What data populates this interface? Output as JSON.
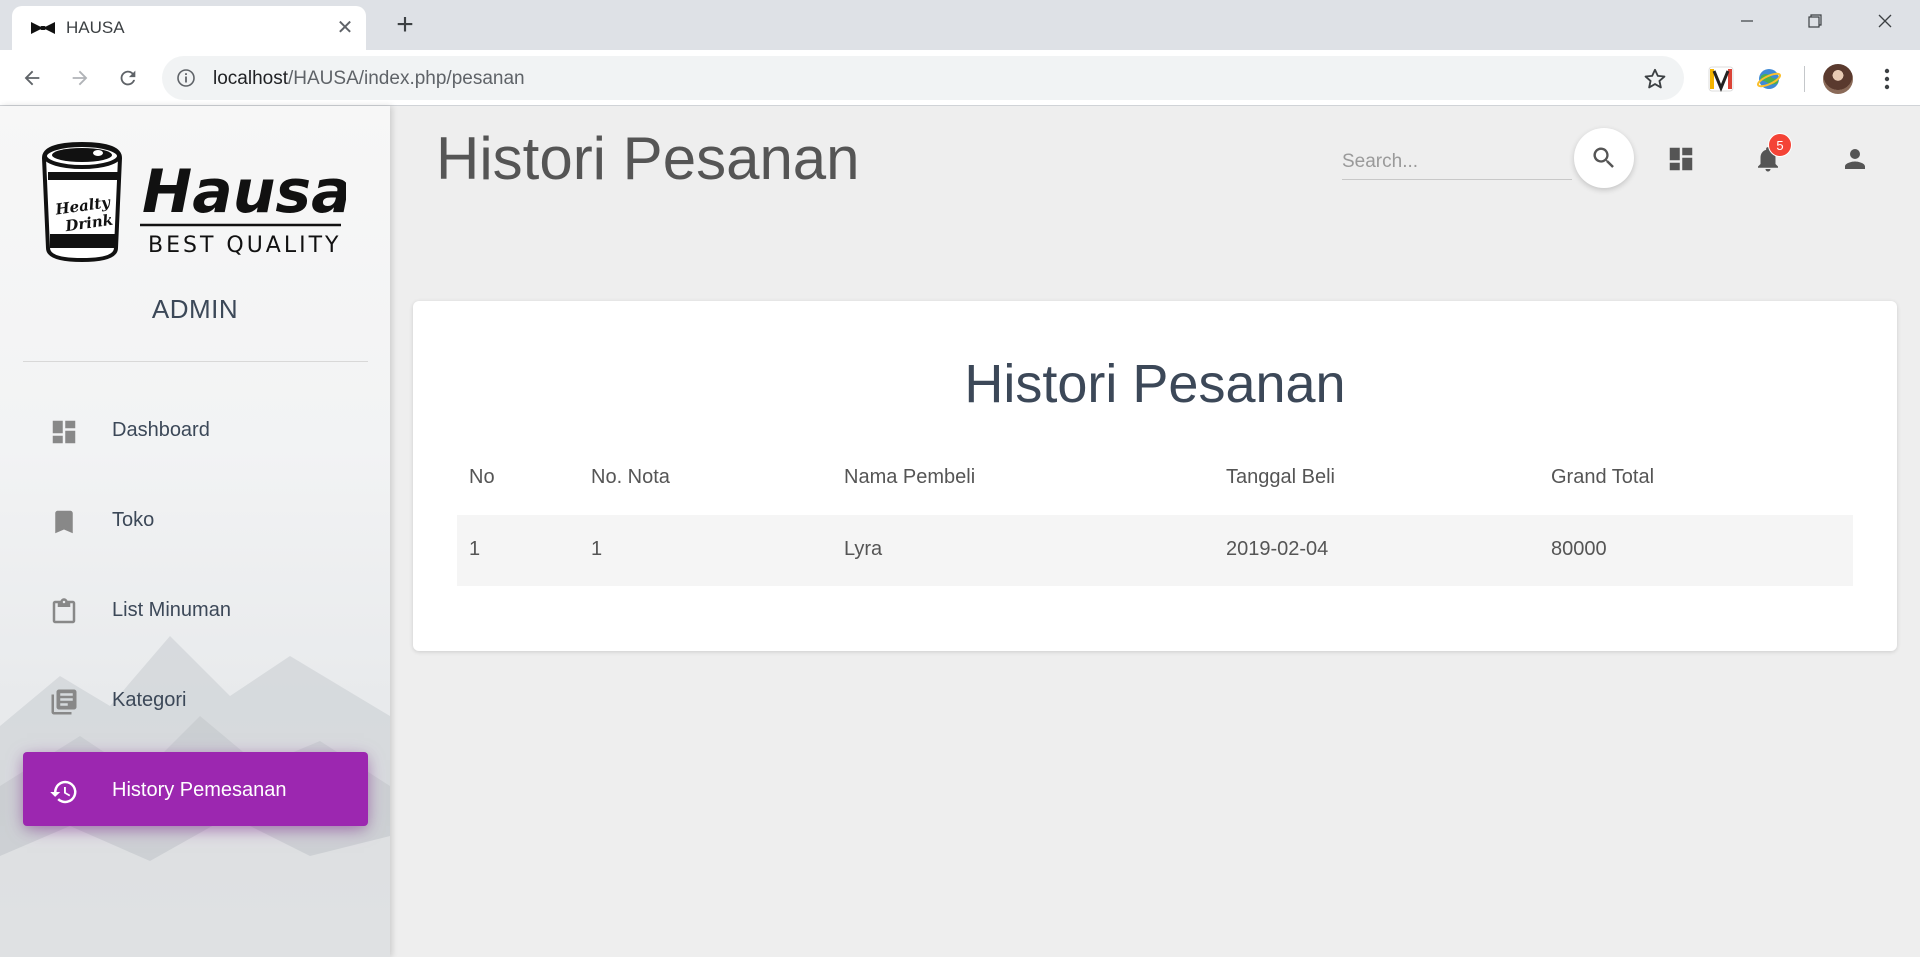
{
  "browser": {
    "tab_title": "HAUSA",
    "tab_favicon": "bowtie-icon",
    "url_host": "localhost",
    "url_path": "/HAUSA/index.php/pesanan"
  },
  "sidebar": {
    "logo": {
      "brand": "Hausa",
      "tagline": "BEST QUALITY",
      "cup_text": "Healty Drink"
    },
    "role_label": "ADMIN",
    "items": [
      {
        "label": "Dashboard",
        "icon": "dashboard-icon",
        "active": false
      },
      {
        "label": "Toko",
        "icon": "bookmark-icon",
        "active": false
      },
      {
        "label": "List Minuman",
        "icon": "clipboard-icon",
        "active": false
      },
      {
        "label": "Kategori",
        "icon": "library-books-icon",
        "active": false
      },
      {
        "label": "History Pemesanan",
        "icon": "history-icon",
        "active": true
      }
    ]
  },
  "header": {
    "title": "Histori Pesanan",
    "search_placeholder": "Search...",
    "notification_count": "5"
  },
  "card": {
    "title": "Histori Pesanan",
    "columns": [
      "No",
      "No. Nota",
      "Nama Pembeli",
      "Tanggal Beli",
      "Grand Total"
    ],
    "rows": [
      [
        "1",
        "1",
        "Lyra",
        "2019-02-04",
        "80000"
      ]
    ]
  },
  "colors": {
    "accent": "#9c27b0",
    "badge": "#f44336"
  }
}
